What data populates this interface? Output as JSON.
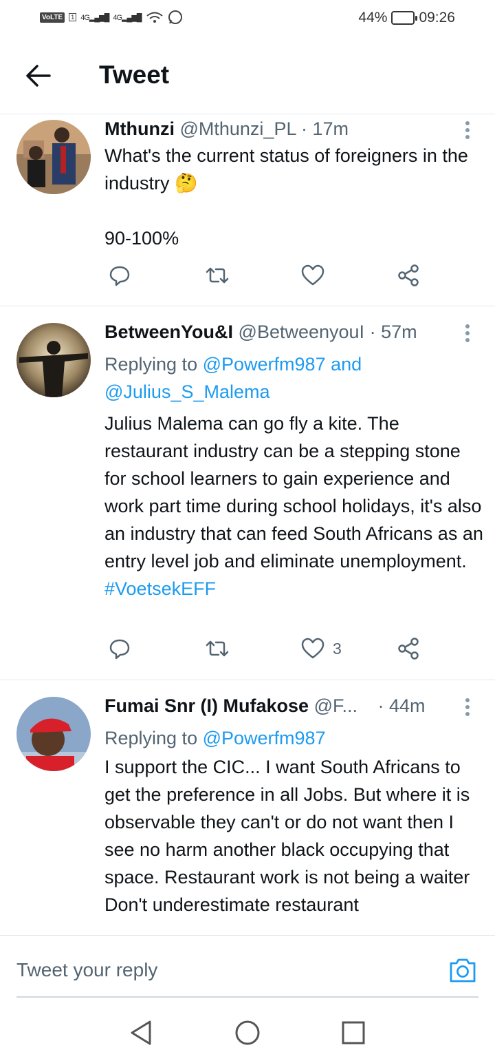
{
  "status_bar": {
    "volte": "VoLTE",
    "sim": "1",
    "net1": "4G",
    "net2": "4G",
    "battery": "44%",
    "time": "09:26"
  },
  "header": {
    "title": "Tweet"
  },
  "tweets": [
    {
      "name": "Mthunzi",
      "handle": "@Mthunzi_PL",
      "time": "· 17m",
      "reply_to_prefix": "",
      "reply_to_links": "",
      "text": "What's the current status of foreigners in the industry 🤔",
      "text2": "90-100%",
      "likes": ""
    },
    {
      "name": "BetweenYou&I",
      "handle": "@BetweenyouI",
      "time": "· 57m",
      "reply_to_prefix": "Replying to",
      "reply_to_links": "@Powerfm987 and @Julius_S_Malema",
      "text": "Julius Malema can go fly a kite. The restaurant industry can be a stepping stone for school learners to gain experience and work part time during school holidays, it's also an industry that can feed South Africans as an entry level job and eliminate unemployment.",
      "hashtag": "#VoetsekEFF",
      "likes": "3"
    },
    {
      "name": "Fumai Snr (I) Mufakose",
      "handle": "@F...",
      "time": "· 44m",
      "reply_to_prefix": "Replying to",
      "reply_to_links": "@Powerfm987",
      "text": "I support the CIC... I want South Africans to get the preference in all Jobs. But where it is observable they can't or do not want then I see no harm another black occupying that space. Restaurant work is not being a waiter Don't underestimate restaurant",
      "likes": ""
    }
  ],
  "reply_bar": {
    "placeholder": "Tweet your reply"
  },
  "colors": {
    "link": "#1d9bf0",
    "muted": "#536471",
    "divider": "#e1e8ed"
  }
}
